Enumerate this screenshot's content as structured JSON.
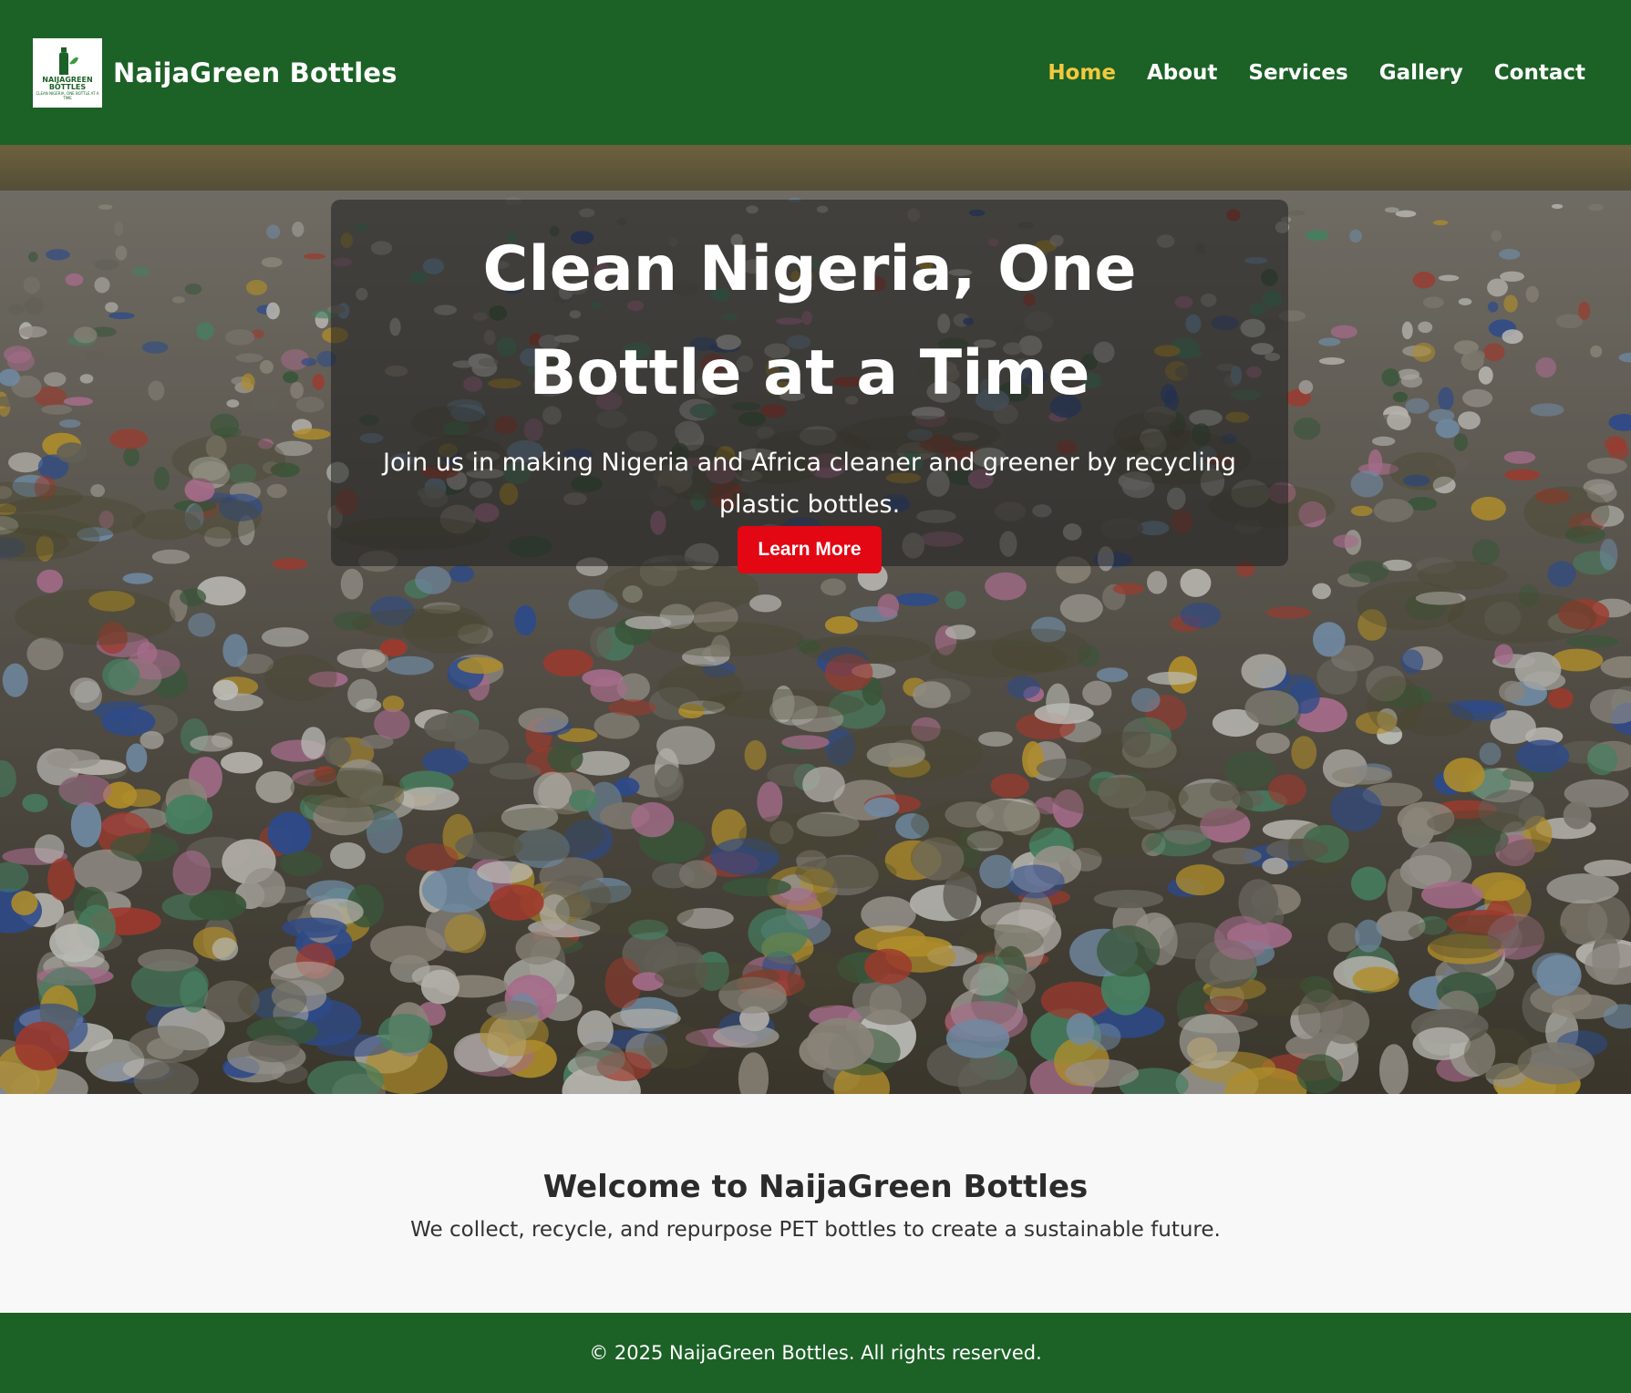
{
  "header": {
    "logo": {
      "line1": "NAIJAGREEN",
      "line2": "BOTTLES",
      "tagline": "CLEAN NIGERIA, ONE BOTTLE AT A TIME",
      "icon": "bottle-leaf-icon"
    },
    "brand_name": "NaijaGreen Bottles",
    "nav": [
      {
        "label": "Home",
        "active": true
      },
      {
        "label": "About",
        "active": false
      },
      {
        "label": "Services",
        "active": false
      },
      {
        "label": "Gallery",
        "active": false
      },
      {
        "label": "Contact",
        "active": false
      }
    ]
  },
  "hero": {
    "title": "Clean Nigeria, One Bottle at a Time",
    "subtitle": "Join us in making Nigeria and Africa cleaner and greener by recycling plastic bottles.",
    "cta_label": "Learn More"
  },
  "welcome": {
    "heading": "Welcome to NaijaGreen Bottles",
    "text": "We collect, recycle, and repurpose PET bottles to create a sustainable future."
  },
  "footer": {
    "copyright": "© 2025 NaijaGreen Bottles. All rights reserved."
  },
  "colors": {
    "brand_green": "#1c6126",
    "nav_active": "#f3c93f",
    "cta_red": "#e30613"
  }
}
